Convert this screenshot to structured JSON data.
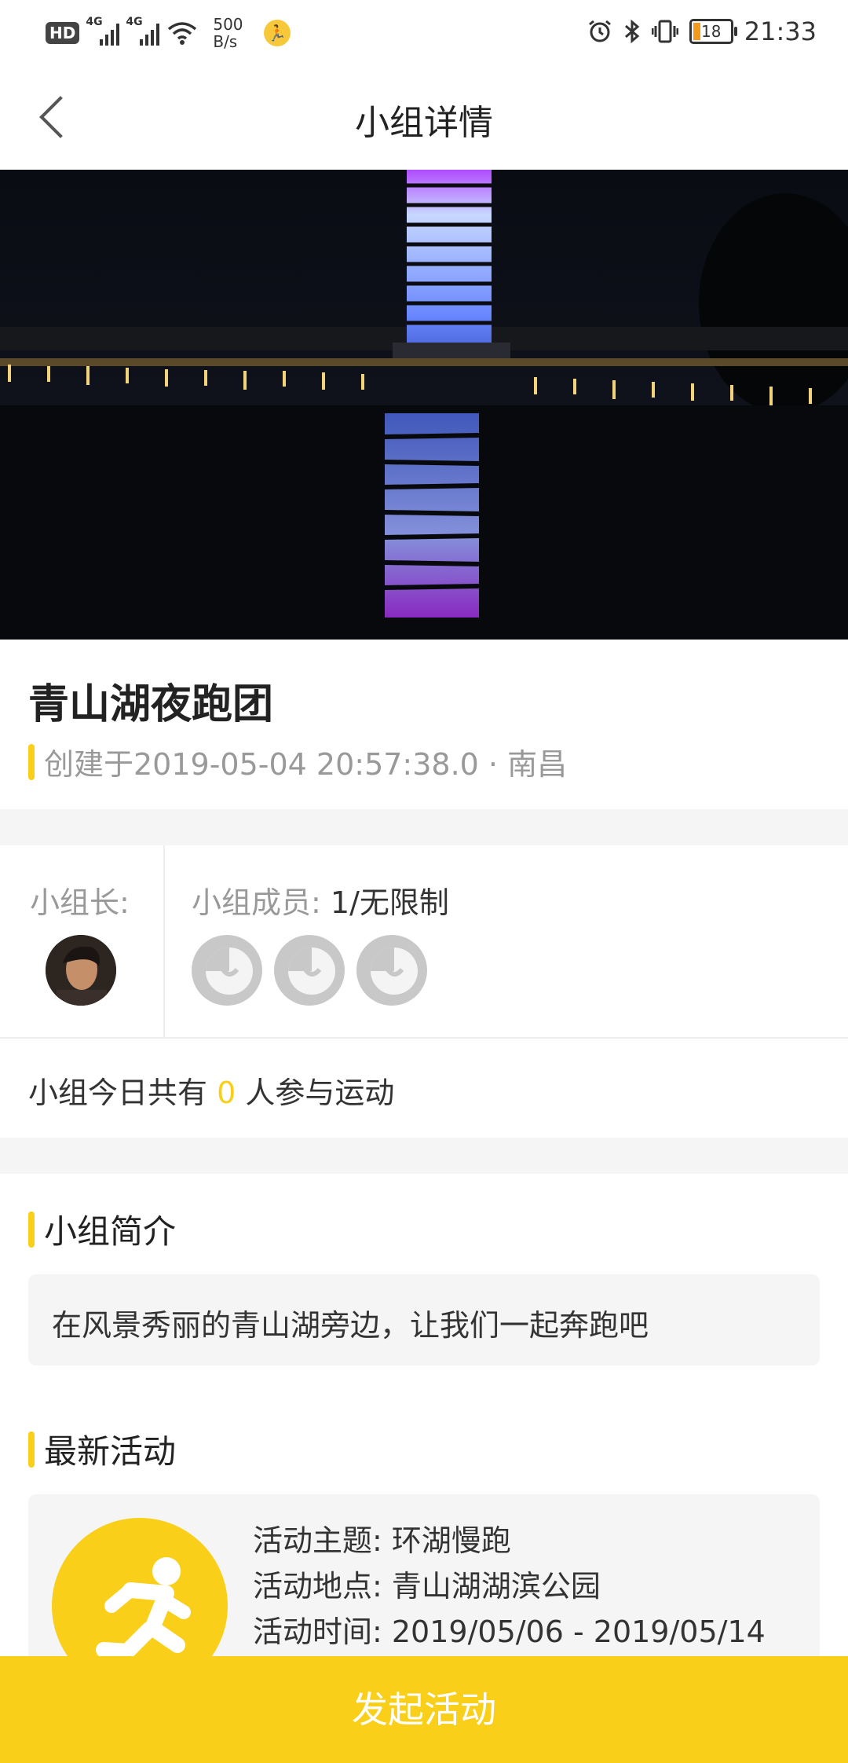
{
  "status_bar": {
    "hd": "HD",
    "sig1": "4G",
    "sig2": "4G",
    "net_speed": "500",
    "net_unit": "B/s",
    "battery": "18",
    "time": "21:33"
  },
  "header": {
    "title": "小组详情"
  },
  "group": {
    "name": "青山湖夜跑团",
    "meta": "创建于2019-05-04 20:57:38.0 · 南昌"
  },
  "members": {
    "leader_label": "小组长:",
    "member_label": "小组成员:",
    "member_count": " 1/无限制"
  },
  "today": {
    "prefix": "小组今日共有 ",
    "count": "0",
    "suffix": " 人参与运动"
  },
  "intro": {
    "title": "小组简介",
    "text": "在风景秀丽的青山湖旁边，让我们一起奔跑吧"
  },
  "activity": {
    "title": "最新活动",
    "theme": "活动主题: 环湖慢跑",
    "location": "活动地点: 青山湖湖滨公园",
    "time": "活动时间: 2019/05/06 - 2019/05/14"
  },
  "bottom_button": "发起活动",
  "colors": {
    "accent": "#f9cf1a",
    "muted": "#999999"
  }
}
